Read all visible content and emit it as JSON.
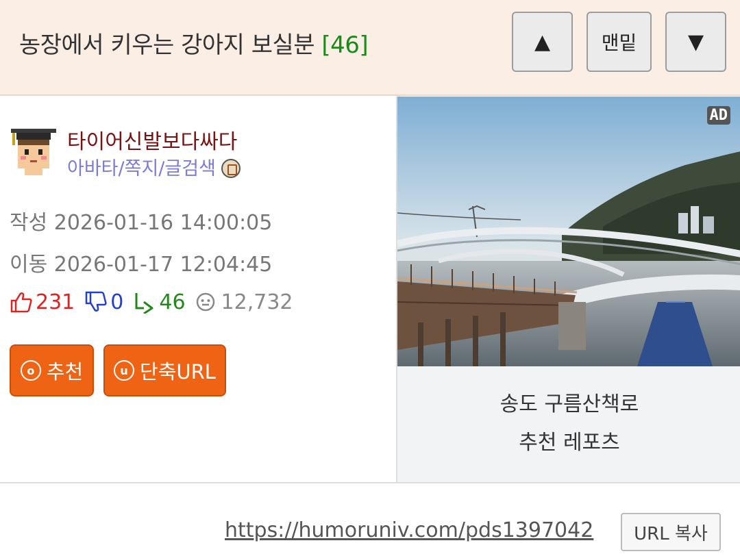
{
  "header": {
    "title": "농장에서 키우는 강아지 보실분",
    "comment_count": "[46]",
    "btn_up": "▲",
    "btn_bottom": "맨밑",
    "btn_down": "▼"
  },
  "author": {
    "nickname": "타이어신발보다싸다",
    "links": "아바타/쪽지/글검색"
  },
  "meta": {
    "created": "작성 2026-01-16 14:00:05",
    "moved": "이동 2026-01-17 12:04:45"
  },
  "stats": {
    "upvotes": "231",
    "downvotes": "0",
    "replies": "46",
    "views": "12,732"
  },
  "actions": {
    "recommend_icon": "o",
    "recommend": "추천",
    "shorturl_icon": "u",
    "shorturl": "단축URL"
  },
  "ad": {
    "label": "AD",
    "caption_line1": "송도 구름산책로",
    "caption_line2": "추천 레포츠"
  },
  "footer": {
    "url": "https://humoruniv.com/pds1397042",
    "copy_button": "URL 복사"
  },
  "colors": {
    "header_bg": "#fbeee5",
    "count": "#1a8a1a",
    "nickname": "#7a1212",
    "links": "#7b7bd8",
    "upvote": "#dd2222",
    "downvote": "#2240d0",
    "reply": "#22881a",
    "action_button": "#ee6414"
  }
}
